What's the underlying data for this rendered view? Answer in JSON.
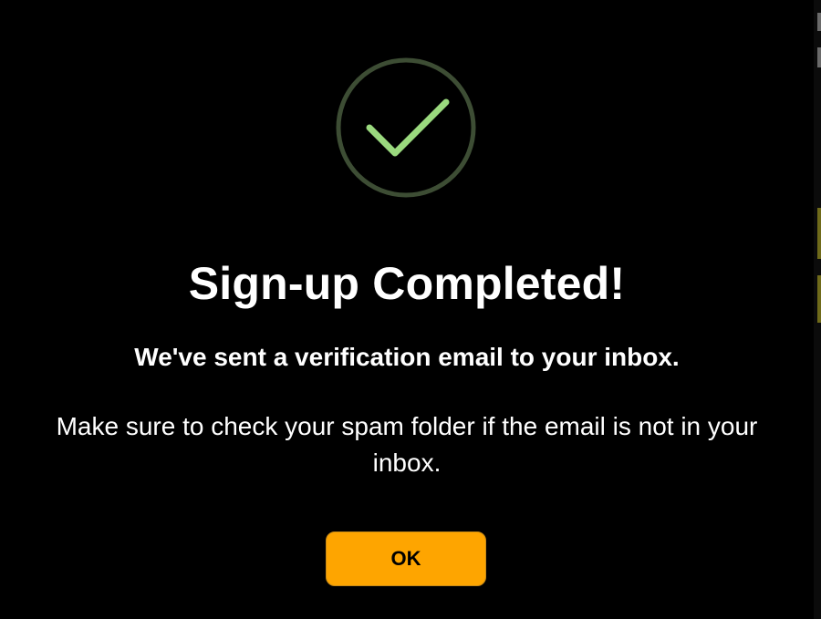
{
  "dialog": {
    "icon": "checkmark-circle-icon",
    "title": "Sign-up Completed!",
    "subtitle": "We've sent a verification email to your inbox.",
    "message": "Make sure to check your spam folder if the email is not in your inbox.",
    "ok_label": "OK"
  },
  "colors": {
    "background": "#000000",
    "check": "#9AD97E",
    "ring": "#3D4D34",
    "button": "#FEA500",
    "button_text": "#000000",
    "text": "#FFFFFF"
  }
}
